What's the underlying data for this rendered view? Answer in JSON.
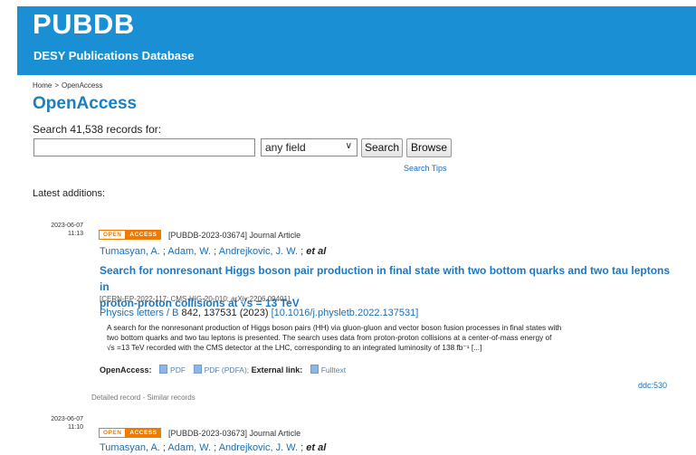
{
  "header": {
    "brand": "PUBDB",
    "subtitle": "DESY Publications Database",
    "brand_color": "#1a8fd4"
  },
  "breadcrumb": {
    "home": "Home",
    "separator": ">",
    "current": "OpenAccess"
  },
  "page_title": "OpenAccess",
  "search": {
    "label": "Search 41,538 records for:",
    "value": "",
    "field_selected": "any field",
    "search_button": "Search",
    "browse_button": "Browse",
    "tips_link": "Search Tips"
  },
  "latest_label": "Latest additions:",
  "badge": {
    "left": "OPEN",
    "right": "ACCESS",
    "color": "#f07a00"
  },
  "records": [
    {
      "date": "2023-06-07",
      "time": "11:13",
      "id_type": "[PUBDB-2023-03674] Journal Article",
      "authors": [
        "Tumasyan, A.",
        "Adam, W.",
        "Andrejkovic, J. W."
      ],
      "author_sep": ";",
      "et_al": "et al",
      "title_line1": "Search for nonresonant Higgs boson pair production in final state with two bottom quarks and two tau leptons in",
      "title_line2": "proton-proton collisions at √s = 13 TeV",
      "report_numbers": "[CERN-EP-2022-117; CMS-HIG-20-010; arXiv:2206.09401]",
      "journal": "Physics letters / B",
      "journal_details": "842, 137531 (2023)",
      "doi": "[10.1016/j.physletb.2022.137531]",
      "abstract_line1": "A search for the nonresonant production of Higgs boson pairs (HH) via gluon-gluon and vector boson fusion processes in final states with",
      "abstract_line2": "two bottom quarks and two tau leptons is presented. The search uses data from proton-proton collisions at a center-of-mass energy of",
      "abstract_line3": "√s =13 TeV recorded with the CMS detector at the LHC, corresponding to an integrated luminosity of 138 fb⁻¹ [...]",
      "openaccess_label": "OpenAccess:",
      "pdf": "PDF",
      "pdfa": "PDF (PDFA);",
      "external_label": "External link:",
      "fulltext": "Fulltext",
      "ddc": "ddc:530",
      "detailed": "Detailed record",
      "detail_sep": "-",
      "similar": "Similar records"
    },
    {
      "date": "2023-06-07",
      "time": "11:10",
      "id_type": "[PUBDB-2023-03673] Journal Article",
      "authors": [
        "Tumasyan, A.",
        "Adam, W.",
        "Andrejkovic, J. W."
      ],
      "author_sep": ";",
      "et_al": "et al"
    }
  ]
}
